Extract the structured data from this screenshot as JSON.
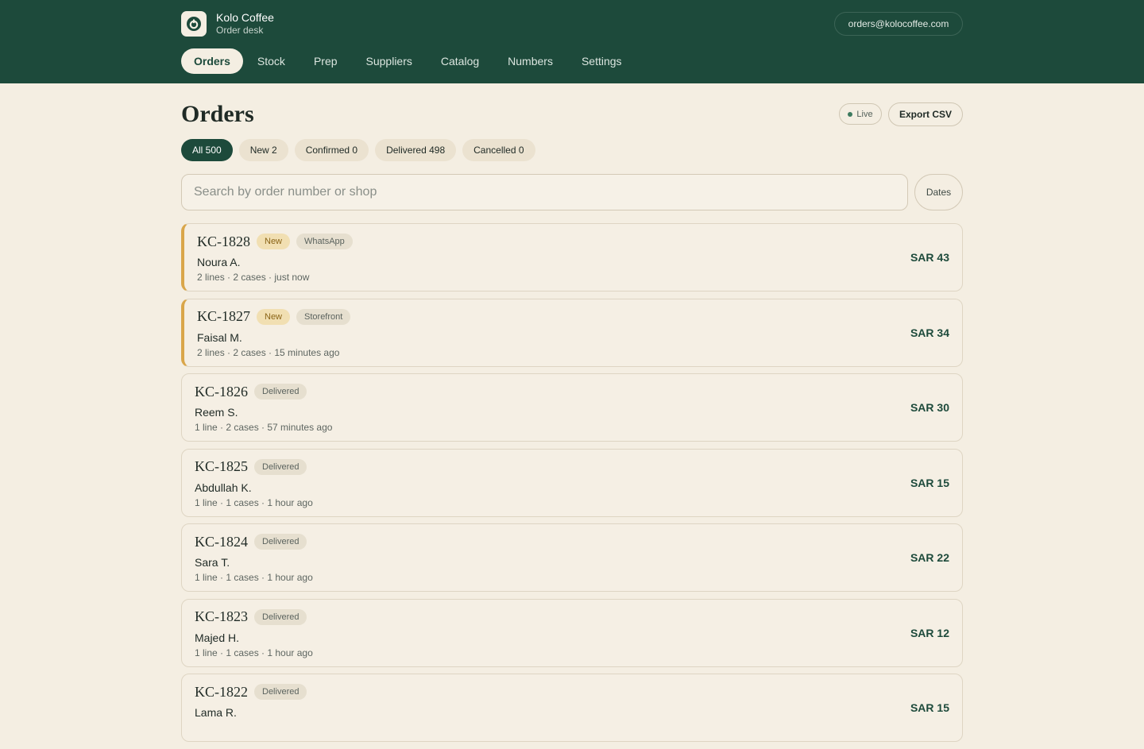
{
  "brand": {
    "name": "Kolo Coffee",
    "subtitle": "Order desk",
    "logo_icon": "power-ring-icon"
  },
  "account": {
    "email": "orders@kolocoffee.com"
  },
  "nav": [
    {
      "label": "Orders",
      "active": true
    },
    {
      "label": "Stock"
    },
    {
      "label": "Prep"
    },
    {
      "label": "Suppliers"
    },
    {
      "label": "Catalog"
    },
    {
      "label": "Numbers"
    },
    {
      "label": "Settings"
    }
  ],
  "page": {
    "title": "Orders",
    "live_label": "Live",
    "export_label": "Export CSV"
  },
  "filters": [
    {
      "label": "All 500",
      "active": true
    },
    {
      "label": "New 2"
    },
    {
      "label": "Confirmed 0"
    },
    {
      "label": "Delivered 498"
    },
    {
      "label": "Cancelled 0"
    }
  ],
  "search": {
    "placeholder": "Search by order number or shop",
    "value": ""
  },
  "dates_label": "Dates",
  "orders": [
    {
      "number": "KC-1828",
      "status": "New",
      "channel": "WhatsApp",
      "customer": "Noura A.",
      "meta": "2 lines · 2 cases · just now",
      "amount": "SAR 43"
    },
    {
      "number": "KC-1827",
      "status": "New",
      "channel": "Storefront",
      "customer": "Faisal M.",
      "meta": "2 lines · 2 cases · 15 minutes ago",
      "amount": "SAR 34"
    },
    {
      "number": "KC-1826",
      "status": "Delivered",
      "customer": "Reem S.",
      "meta": "1 line · 2 cases · 57 minutes ago",
      "amount": "SAR 30"
    },
    {
      "number": "KC-1825",
      "status": "Delivered",
      "customer": "Abdullah K.",
      "meta": "1 line · 1 cases · 1 hour ago",
      "amount": "SAR 15"
    },
    {
      "number": "KC-1824",
      "status": "Delivered",
      "customer": "Sara T.",
      "meta": "1 line · 1 cases · 1 hour ago",
      "amount": "SAR 22"
    },
    {
      "number": "KC-1823",
      "status": "Delivered",
      "customer": "Majed H.",
      "meta": "1 line · 1 cases · 1 hour ago",
      "amount": "SAR 12"
    },
    {
      "number": "KC-1822",
      "status": "Delivered",
      "customer": "Lama R.",
      "meta": "",
      "amount": "SAR 15"
    }
  ],
  "colors": {
    "header_bg": "#1d4a3b",
    "page_bg": "#f4eee2",
    "accent": "#1d4a3b",
    "new_accent": "#d9a64a"
  }
}
